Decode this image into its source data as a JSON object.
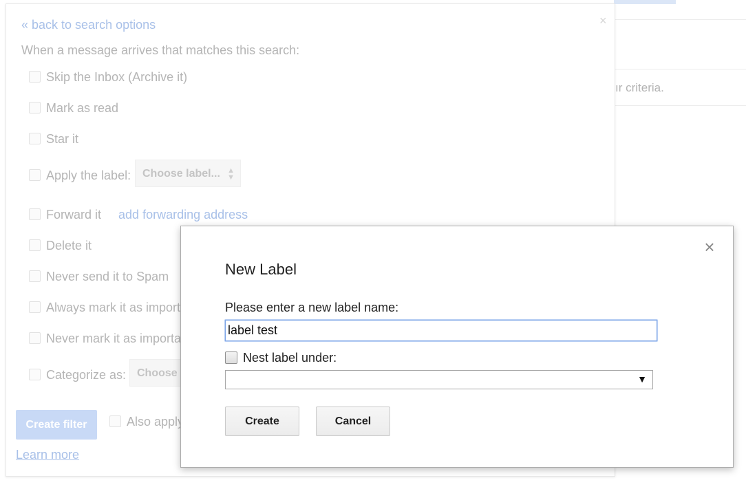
{
  "background": {
    "criteria_fragment": "ır criteria."
  },
  "filter_panel": {
    "close_glyph": "×",
    "back_link": "« back to search options",
    "intro": "When a message arrives that matches this search:",
    "options": [
      {
        "label": "Skip the Inbox (Archive it)"
      },
      {
        "label": "Mark as read"
      },
      {
        "label": "Star it"
      },
      {
        "label": "Apply the label:"
      },
      {
        "label": "Forward it"
      },
      {
        "label": "Delete it"
      },
      {
        "label": "Never send it to Spam"
      },
      {
        "label": "Always mark it as import"
      },
      {
        "label": "Never mark it as importa"
      },
      {
        "label": "Categorize as:"
      }
    ],
    "label_select": "Choose label...",
    "category_select": "Choose",
    "forward_link": "add forwarding address",
    "create_filter_button": "Create filter",
    "also_apply": "Also apply",
    "learn_more": "Learn more"
  },
  "modal": {
    "close_glyph": "×",
    "title": "New Label",
    "prompt": "Please enter a new label name:",
    "input_value": "label test",
    "nest_label": "Nest label under:",
    "nest_checked": false,
    "nest_select_value": "",
    "create_button": "Create",
    "cancel_button": "Cancel"
  }
}
